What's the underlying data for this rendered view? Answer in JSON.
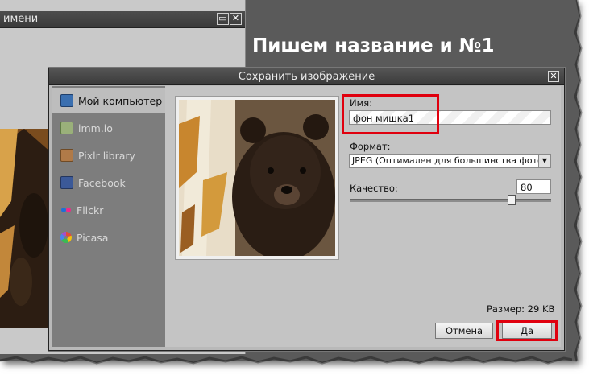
{
  "background_window": {
    "title": "имени",
    "minimize_glyph": "▭",
    "close_glyph": "✕"
  },
  "annotation": {
    "heading": "Пишем название и №1",
    "highlight_color": "#e0000e"
  },
  "dialog": {
    "title": "Сохранить изображение",
    "close_glyph": "✕",
    "sidebar": {
      "items": [
        {
          "label": "Мой компьютер",
          "icon": "computer-icon",
          "active": true
        },
        {
          "label": "imm.io",
          "icon": "image-icon",
          "active": false
        },
        {
          "label": "Pixlr library",
          "icon": "library-icon",
          "active": false
        },
        {
          "label": "Facebook",
          "icon": "facebook-icon",
          "active": false
        },
        {
          "label": "Flickr",
          "icon": "flickr-icon",
          "active": false
        },
        {
          "label": "Picasa",
          "icon": "picasa-icon",
          "active": false
        }
      ]
    },
    "form": {
      "name_label": "Имя:",
      "name_value": "фон мишка1",
      "format_label": "Формат:",
      "format_value": "JPEG (Оптимален для большинства фото",
      "quality_label": "Качество:",
      "quality_value": "80",
      "quality_slider_fraction": 0.8,
      "size_text": "Размер: 29 KB"
    },
    "buttons": {
      "cancel": "Отмена",
      "ok": "Да"
    }
  }
}
